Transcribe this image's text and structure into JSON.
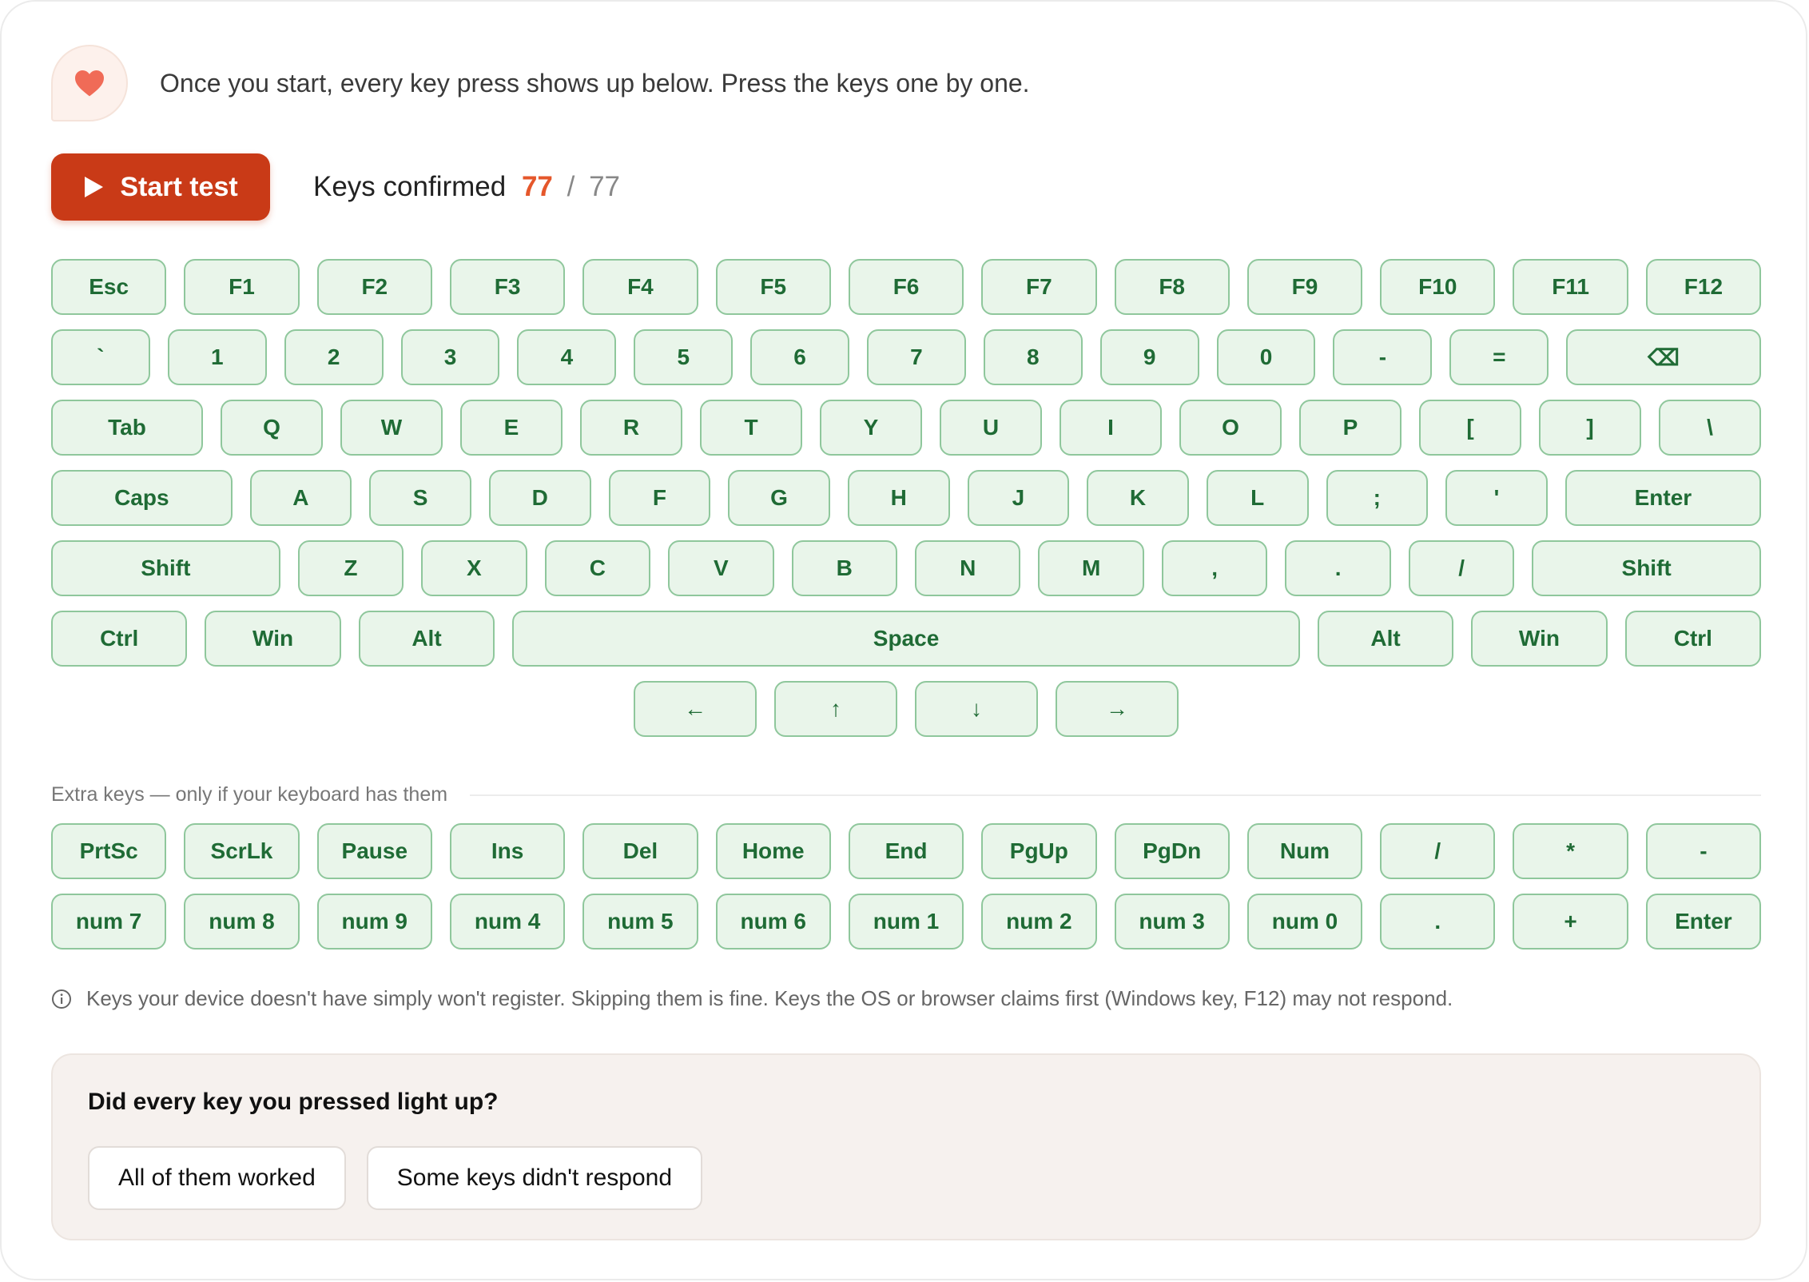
{
  "notice": {
    "icon": "heart-icon",
    "text": "Once you start, every key press shows up below. Press the keys one by one."
  },
  "toolbar": {
    "start_label": "Start test",
    "confirmed_label": "Keys confirmed",
    "confirmed_count": "77",
    "separator": "/",
    "total": "77"
  },
  "keyboard": {
    "rows": [
      [
        {
          "label": "Esc",
          "w": 1
        },
        {
          "label": "F1",
          "w": 1
        },
        {
          "label": "F2",
          "w": 1
        },
        {
          "label": "F3",
          "w": 1
        },
        {
          "label": "F4",
          "w": 1
        },
        {
          "label": "F5",
          "w": 1
        },
        {
          "label": "F6",
          "w": 1
        },
        {
          "label": "F7",
          "w": 1
        },
        {
          "label": "F8",
          "w": 1
        },
        {
          "label": "F9",
          "w": 1
        },
        {
          "label": "F10",
          "w": 1
        },
        {
          "label": "F11",
          "w": 1
        },
        {
          "label": "F12",
          "w": 1
        }
      ],
      [
        {
          "label": "`",
          "w": 1
        },
        {
          "label": "1",
          "w": 1
        },
        {
          "label": "2",
          "w": 1
        },
        {
          "label": "3",
          "w": 1
        },
        {
          "label": "4",
          "w": 1
        },
        {
          "label": "5",
          "w": 1
        },
        {
          "label": "6",
          "w": 1
        },
        {
          "label": "7",
          "w": 1
        },
        {
          "label": "8",
          "w": 1
        },
        {
          "label": "9",
          "w": 1
        },
        {
          "label": "0",
          "w": 1
        },
        {
          "label": "-",
          "w": 1
        },
        {
          "label": "=",
          "w": 1
        },
        {
          "label": "⌫",
          "w": 2
        }
      ],
      [
        {
          "label": "Tab",
          "w": 1.5
        },
        {
          "label": "Q",
          "w": 1
        },
        {
          "label": "W",
          "w": 1
        },
        {
          "label": "E",
          "w": 1
        },
        {
          "label": "R",
          "w": 1
        },
        {
          "label": "T",
          "w": 1
        },
        {
          "label": "Y",
          "w": 1
        },
        {
          "label": "U",
          "w": 1
        },
        {
          "label": "I",
          "w": 1
        },
        {
          "label": "O",
          "w": 1
        },
        {
          "label": "P",
          "w": 1
        },
        {
          "label": "[",
          "w": 1
        },
        {
          "label": "]",
          "w": 1
        },
        {
          "label": "\\",
          "w": 1
        }
      ],
      [
        {
          "label": "Caps",
          "w": 1.8
        },
        {
          "label": "A",
          "w": 1
        },
        {
          "label": "S",
          "w": 1
        },
        {
          "label": "D",
          "w": 1
        },
        {
          "label": "F",
          "w": 1
        },
        {
          "label": "G",
          "w": 1
        },
        {
          "label": "H",
          "w": 1
        },
        {
          "label": "J",
          "w": 1
        },
        {
          "label": "K",
          "w": 1
        },
        {
          "label": "L",
          "w": 1
        },
        {
          "label": ";",
          "w": 1
        },
        {
          "label": "'",
          "w": 1
        },
        {
          "label": "Enter",
          "w": 1.95
        }
      ],
      [
        {
          "label": "Shift",
          "w": 2.2
        },
        {
          "label": "Z",
          "w": 1
        },
        {
          "label": "X",
          "w": 1
        },
        {
          "label": "C",
          "w": 1
        },
        {
          "label": "V",
          "w": 1
        },
        {
          "label": "B",
          "w": 1
        },
        {
          "label": "N",
          "w": 1
        },
        {
          "label": "M",
          "w": 1
        },
        {
          "label": ",",
          "w": 1
        },
        {
          "label": ".",
          "w": 1
        },
        {
          "label": "/",
          "w": 1
        },
        {
          "label": "Shift",
          "w": 2.2
        }
      ],
      [
        {
          "label": "Ctrl",
          "w": 1
        },
        {
          "label": "Win",
          "w": 1
        },
        {
          "label": "Alt",
          "w": 1
        },
        {
          "label": "Space",
          "w": 5.9
        },
        {
          "label": "Alt",
          "w": 1
        },
        {
          "label": "Win",
          "w": 1
        },
        {
          "label": "Ctrl",
          "w": 1
        }
      ]
    ],
    "arrows": [
      {
        "label": "←",
        "icon": "arrow-left-icon"
      },
      {
        "label": "↑",
        "icon": "arrow-up-icon"
      },
      {
        "label": "↓",
        "icon": "arrow-down-icon"
      },
      {
        "label": "→",
        "icon": "arrow-right-icon"
      }
    ]
  },
  "extra": {
    "label": "Extra keys — only if your keyboard has them",
    "rows": [
      [
        "PrtSc",
        "ScrLk",
        "Pause",
        "Ins",
        "Del",
        "Home",
        "End",
        "PgUp",
        "PgDn",
        "Num",
        "/",
        "*",
        "-"
      ],
      [
        "num 7",
        "num 8",
        "num 9",
        "num 4",
        "num 5",
        "num 6",
        "num 1",
        "num 2",
        "num 3",
        "num 0",
        ".",
        "+",
        "Enter"
      ]
    ]
  },
  "info": {
    "icon": "info-icon",
    "text": "Keys your device doesn't have simply won't register. Skipping them is fine. Keys the OS or browser claims first (Windows key, F12) may not respond."
  },
  "feedback": {
    "question": "Did every key you pressed light up?",
    "yes_label": "All of them worked",
    "no_label": "Some keys didn't respond"
  },
  "colors": {
    "accent": "#c93a17",
    "count_highlight": "#e5572b",
    "key_bg": "#e9f5ea",
    "key_border": "#8fc79c",
    "key_text": "#1f6b35",
    "feedback_bg": "#f6f1ee"
  }
}
